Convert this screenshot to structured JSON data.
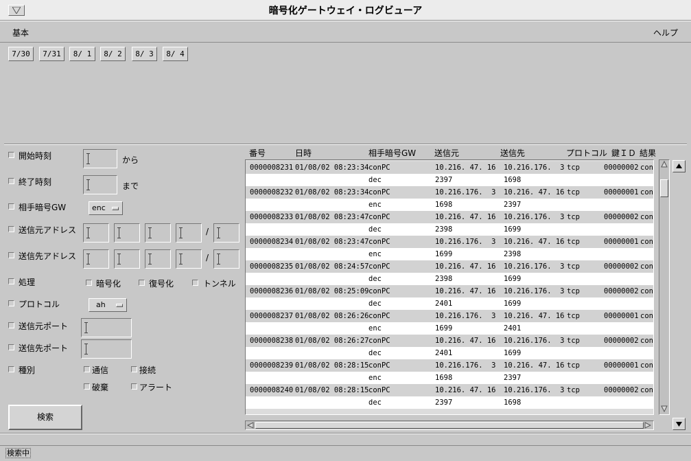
{
  "window": {
    "title": "暗号化ゲートウェイ・ログビューア"
  },
  "menu": {
    "basic": "基本",
    "help": "ヘルプ"
  },
  "date_tabs": [
    {
      "label": "7/30",
      "active": false
    },
    {
      "label": "7/31",
      "active": false
    },
    {
      "label": "8/ 1",
      "active": false
    },
    {
      "label": "8/ 2",
      "active": true
    },
    {
      "label": "8/ 3",
      "active": true
    },
    {
      "label": "8/ 4",
      "active": false
    }
  ],
  "filters": {
    "start_time": {
      "label": "開始時刻",
      "suffix": "から",
      "value": ""
    },
    "end_time": {
      "label": "終了時刻",
      "suffix": "まで",
      "value": ""
    },
    "peer_gw": {
      "label": "相手暗号GW",
      "selected": "enc"
    },
    "src_address": {
      "label": "送信元アドレス",
      "slash": "/"
    },
    "dst_address": {
      "label": "送信先アドレス",
      "slash": "/"
    },
    "process": {
      "label": "処理",
      "encrypt": "暗号化",
      "decrypt": "復号化",
      "tunnel": "トンネル"
    },
    "protocol": {
      "label": "プロトコル",
      "selected": "ah"
    },
    "src_port": {
      "label": "送信元ポート",
      "value": ""
    },
    "dst_port": {
      "label": "送信先ポート",
      "value": ""
    },
    "category": {
      "label": "種別",
      "communication": "通信",
      "connection": "接続",
      "discard": "破棄",
      "alert": "アラート"
    }
  },
  "search_button": "検索",
  "table": {
    "headers": {
      "number": "番号",
      "datetime": "日時",
      "peer": "相手暗号GW",
      "src": "送信元",
      "dst": "送信先",
      "protocol": "プロトコル",
      "key_id": "鍵ＩＤ",
      "result": "結果"
    },
    "rows": [
      {
        "number": "0000008231",
        "datetime": "01/08/02 08:23:34",
        "peer": "conPC",
        "src": "10.216. 47. 16",
        "dst": "10.216.176.  3",
        "protocol": "tcp",
        "key_id": "00000002",
        "result": "con"
      },
      {
        "number": "",
        "datetime": "",
        "peer": "dec",
        "src": "2397",
        "dst": "1698",
        "protocol": "",
        "key_id": "",
        "result": ""
      },
      {
        "number": "0000008232",
        "datetime": "01/08/02 08:23:34",
        "peer": "conPC",
        "src": "10.216.176.  3",
        "dst": "10.216. 47. 16",
        "protocol": "tcp",
        "key_id": "00000001",
        "result": "con"
      },
      {
        "number": "",
        "datetime": "",
        "peer": "enc",
        "src": "1698",
        "dst": "2397",
        "protocol": "",
        "key_id": "",
        "result": ""
      },
      {
        "number": "0000008233",
        "datetime": "01/08/02 08:23:47",
        "peer": "conPC",
        "src": "10.216. 47. 16",
        "dst": "10.216.176.  3",
        "protocol": "tcp",
        "key_id": "00000002",
        "result": "con"
      },
      {
        "number": "",
        "datetime": "",
        "peer": "dec",
        "src": "2398",
        "dst": "1699",
        "protocol": "",
        "key_id": "",
        "result": ""
      },
      {
        "number": "0000008234",
        "datetime": "01/08/02 08:23:47",
        "peer": "conPC",
        "src": "10.216.176.  3",
        "dst": "10.216. 47. 16",
        "protocol": "tcp",
        "key_id": "00000001",
        "result": "con"
      },
      {
        "number": "",
        "datetime": "",
        "peer": "enc",
        "src": "1699",
        "dst": "2398",
        "protocol": "",
        "key_id": "",
        "result": ""
      },
      {
        "number": "0000008235",
        "datetime": "01/08/02 08:24:57",
        "peer": "conPC",
        "src": "10.216. 47. 16",
        "dst": "10.216.176.  3",
        "protocol": "tcp",
        "key_id": "00000002",
        "result": "con"
      },
      {
        "number": "",
        "datetime": "",
        "peer": "dec",
        "src": "2398",
        "dst": "1699",
        "protocol": "",
        "key_id": "",
        "result": ""
      },
      {
        "number": "0000008236",
        "datetime": "01/08/02 08:25:09",
        "peer": "conPC",
        "src": "10.216. 47. 16",
        "dst": "10.216.176.  3",
        "protocol": "tcp",
        "key_id": "00000002",
        "result": "con"
      },
      {
        "number": "",
        "datetime": "",
        "peer": "dec",
        "src": "2401",
        "dst": "1699",
        "protocol": "",
        "key_id": "",
        "result": ""
      },
      {
        "number": "0000008237",
        "datetime": "01/08/02 08:26:26",
        "peer": "conPC",
        "src": "10.216.176.  3",
        "dst": "10.216. 47. 16",
        "protocol": "tcp",
        "key_id": "00000001",
        "result": "con"
      },
      {
        "number": "",
        "datetime": "",
        "peer": "enc",
        "src": "1699",
        "dst": "2401",
        "protocol": "",
        "key_id": "",
        "result": ""
      },
      {
        "number": "0000008238",
        "datetime": "01/08/02 08:26:27",
        "peer": "conPC",
        "src": "10.216. 47. 16",
        "dst": "10.216.176.  3",
        "protocol": "tcp",
        "key_id": "00000002",
        "result": "con"
      },
      {
        "number": "",
        "datetime": "",
        "peer": "dec",
        "src": "2401",
        "dst": "1699",
        "protocol": "",
        "key_id": "",
        "result": ""
      },
      {
        "number": "0000008239",
        "datetime": "01/08/02 08:28:15",
        "peer": "conPC",
        "src": "10.216.176.  3",
        "dst": "10.216. 47. 16",
        "protocol": "tcp",
        "key_id": "00000001",
        "result": "con"
      },
      {
        "number": "",
        "datetime": "",
        "peer": "enc",
        "src": "1698",
        "dst": "2397",
        "protocol": "",
        "key_id": "",
        "result": ""
      },
      {
        "number": "0000008240",
        "datetime": "01/08/02 08:28:15",
        "peer": "conPC",
        "src": "10.216. 47. 16",
        "dst": "10.216.176.  3",
        "protocol": "tcp",
        "key_id": "00000002",
        "result": "con"
      },
      {
        "number": "",
        "datetime": "",
        "peer": "dec",
        "src": "2397",
        "dst": "1698",
        "protocol": "",
        "key_id": "",
        "result": ""
      }
    ]
  },
  "status": {
    "text": "検索中"
  }
}
